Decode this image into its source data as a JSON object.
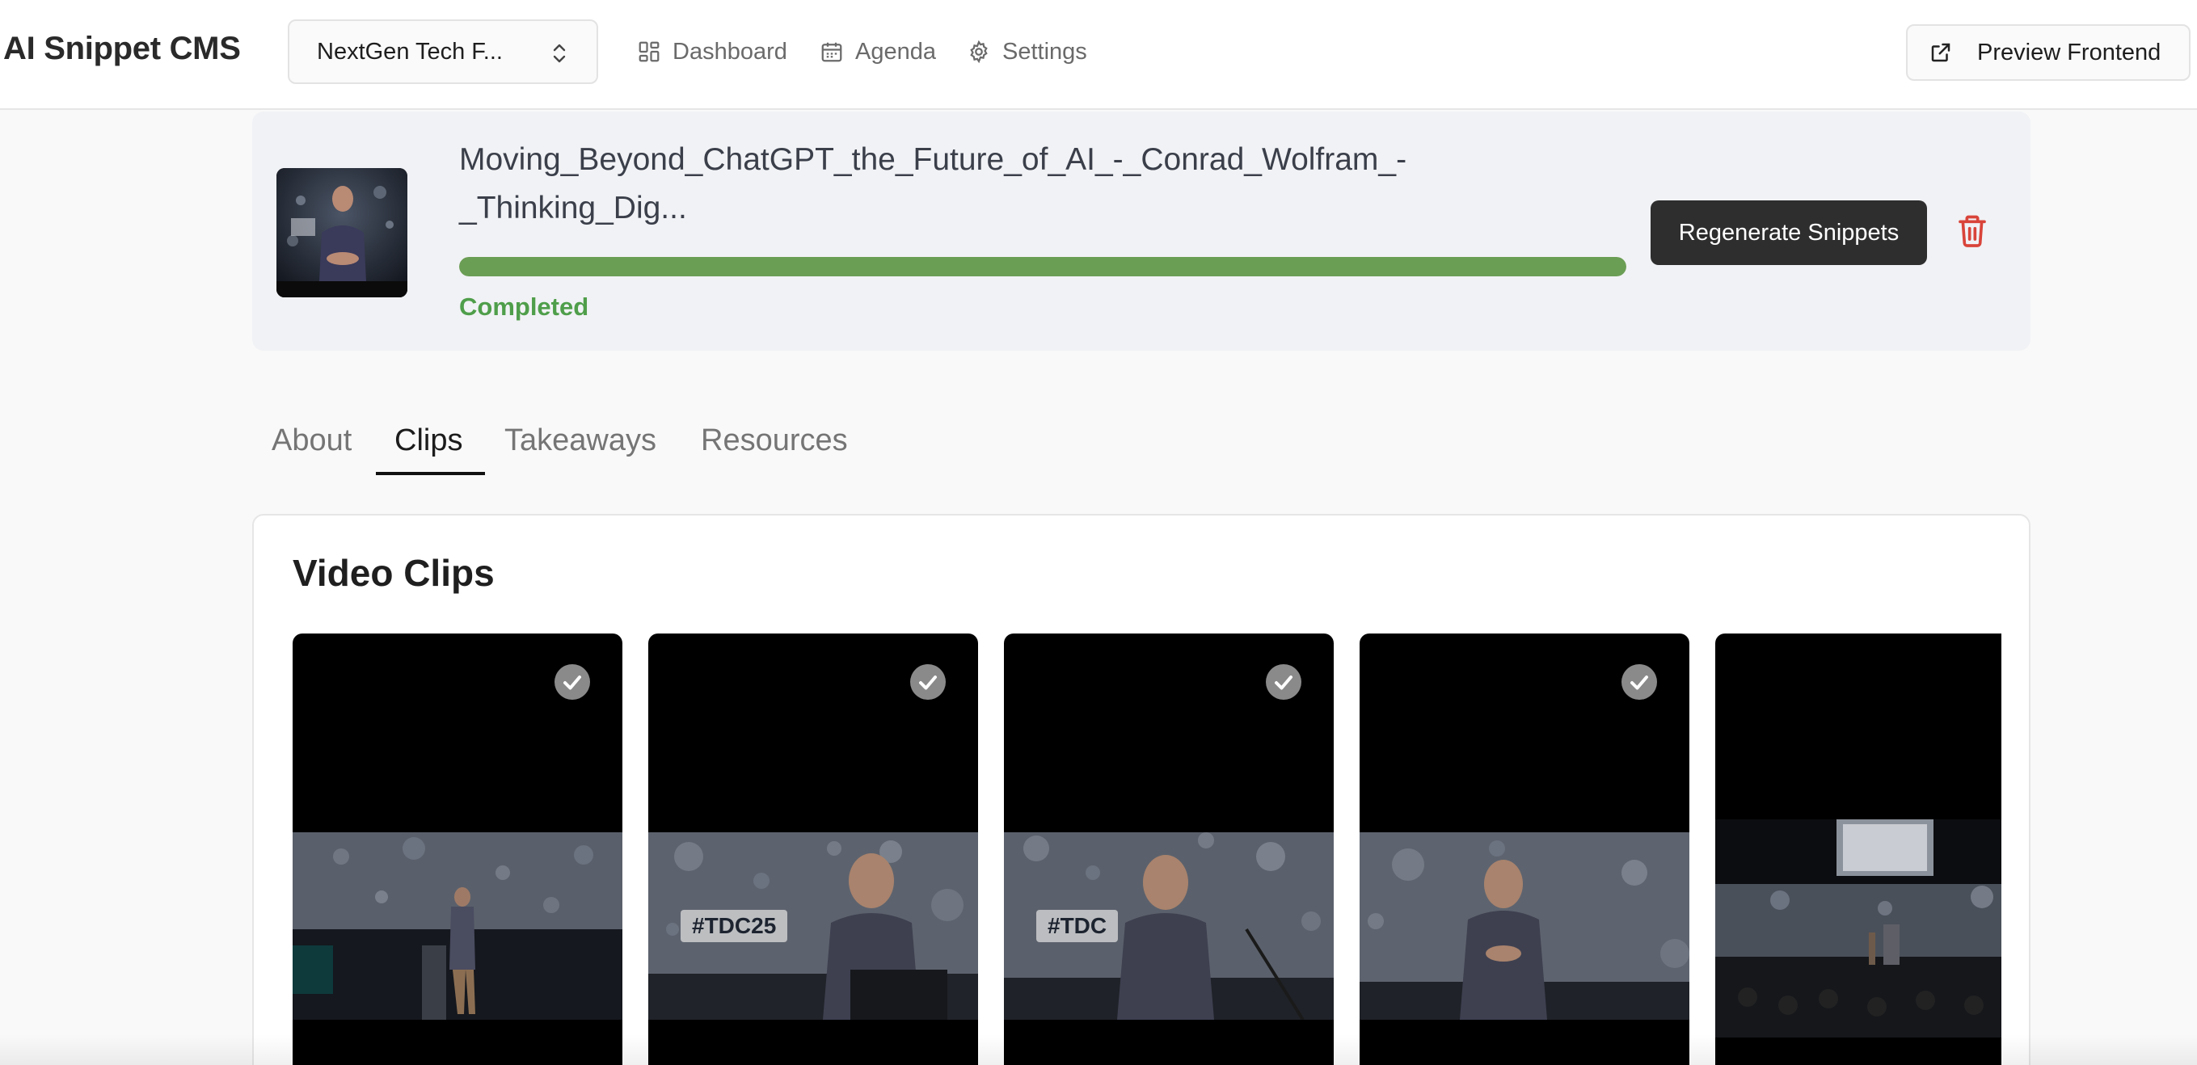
{
  "app": {
    "brand": "AI Snippet CMS"
  },
  "event_selector": {
    "value": "NextGen Tech F..."
  },
  "nav": {
    "items": [
      {
        "label": "Dashboard",
        "icon": "grid-icon"
      },
      {
        "label": "Agenda",
        "icon": "calendar-icon"
      },
      {
        "label": "Settings",
        "icon": "gear-icon"
      }
    ],
    "preview_label": "Preview Frontend"
  },
  "video": {
    "title_line1": "Moving_Beyond_ChatGPT_the_Future_of_AI_-_Conrad_Wolfram_-",
    "title_line2": "_Thinking_Dig...",
    "progress_percent": 100,
    "status": "Completed",
    "regenerate_label": "Regenerate Snippets",
    "colors": {
      "progress": "#6b9e55",
      "status": "#4f9e4a",
      "delete": "#d9443a"
    }
  },
  "tabs": {
    "items": [
      "About",
      "Clips",
      "Takeaways",
      "Resources"
    ],
    "active": "Clips"
  },
  "clips": {
    "title": "Video Clips",
    "items": [
      {
        "selected": true,
        "badge": ""
      },
      {
        "selected": true,
        "badge": "#TDC25"
      },
      {
        "selected": true,
        "badge": "#TDC"
      },
      {
        "selected": true,
        "badge": ""
      },
      {
        "selected": true,
        "badge": ""
      }
    ]
  }
}
